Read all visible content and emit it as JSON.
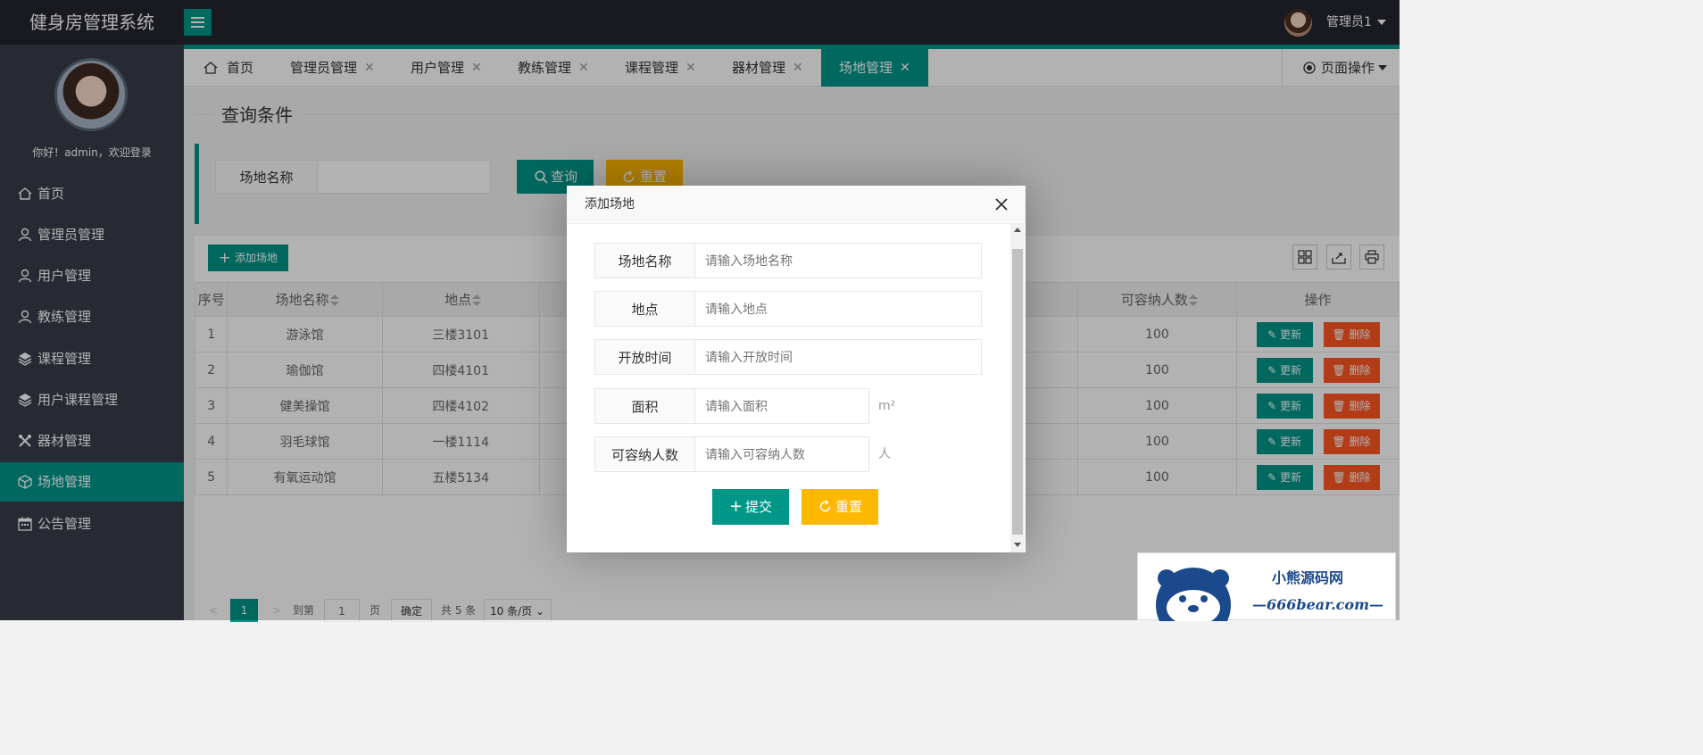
{
  "header": {
    "app_title": "健身房管理系统",
    "user_name": "管理员1",
    "menu_icon": "hamburger-icon"
  },
  "sidebar": {
    "welcome": "你好！admin，欢迎登录",
    "items": [
      {
        "label": "首页",
        "icon": "home-icon"
      },
      {
        "label": "管理员管理",
        "icon": "user-icon"
      },
      {
        "label": "用户管理",
        "icon": "user-icon"
      },
      {
        "label": "教练管理",
        "icon": "user-icon"
      },
      {
        "label": "课程管理",
        "icon": "layers-icon"
      },
      {
        "label": "用户课程管理",
        "icon": "layers-icon"
      },
      {
        "label": "器材管理",
        "icon": "tools-icon"
      },
      {
        "label": "场地管理",
        "icon": "cube-icon",
        "active": true
      },
      {
        "label": "公告管理",
        "icon": "calendar-icon"
      }
    ]
  },
  "tabs": {
    "items": [
      {
        "label": "首页"
      },
      {
        "label": "管理员管理"
      },
      {
        "label": "用户管理"
      },
      {
        "label": "教练管理"
      },
      {
        "label": "课程管理"
      },
      {
        "label": "器材管理"
      },
      {
        "label": "场地管理",
        "active": true
      }
    ],
    "page_ops": "页面操作"
  },
  "query": {
    "legend": "查询条件",
    "field_label": "场地名称",
    "search_btn": "查询",
    "reset_btn": "重置"
  },
  "table": {
    "add_btn": "添加场地",
    "columns": [
      "序号",
      "场地名称",
      "地点",
      "可容纳人数",
      "操作"
    ],
    "update_label": "更新",
    "delete_label": "删除",
    "rows": [
      {
        "no": "1",
        "name": "游泳馆",
        "location": "三楼3101",
        "capacity": "100"
      },
      {
        "no": "2",
        "name": "瑜伽馆",
        "location": "四楼4101",
        "capacity": "100"
      },
      {
        "no": "3",
        "name": "健美操馆",
        "location": "四楼4102",
        "capacity": "100"
      },
      {
        "no": "4",
        "name": "羽毛球馆",
        "location": "一楼1114",
        "capacity": "100"
      },
      {
        "no": "5",
        "name": "有氧运动馆",
        "location": "五楼5134",
        "capacity": "100"
      }
    ]
  },
  "pager": {
    "current": "1",
    "goto_label": "到第",
    "goto_value": "1",
    "page_label": "页",
    "confirm": "确定",
    "total": "共 5 条",
    "per_page": "10 条/页"
  },
  "modal": {
    "title": "添加场地",
    "fields": [
      {
        "label": "场地名称",
        "placeholder": "请输入场地名称",
        "unit": ""
      },
      {
        "label": "地点",
        "placeholder": "请输入地点",
        "unit": ""
      },
      {
        "label": "开放时间",
        "placeholder": "请输入开放时间",
        "unit": ""
      },
      {
        "label": "面积",
        "placeholder": "请输入面积",
        "unit": "m²"
      },
      {
        "label": "可容纳人数",
        "placeholder": "请输入可容纳人数",
        "unit": "人"
      }
    ],
    "submit": "提交",
    "reset": "重置"
  },
  "watermark": {
    "cn": "小熊源码网",
    "en": "—666bear.com—"
  },
  "colors": {
    "primary": "#009688",
    "warn": "#ffb800",
    "danger": "#ff5722",
    "sidebar": "#393d49",
    "header": "#23262e"
  }
}
